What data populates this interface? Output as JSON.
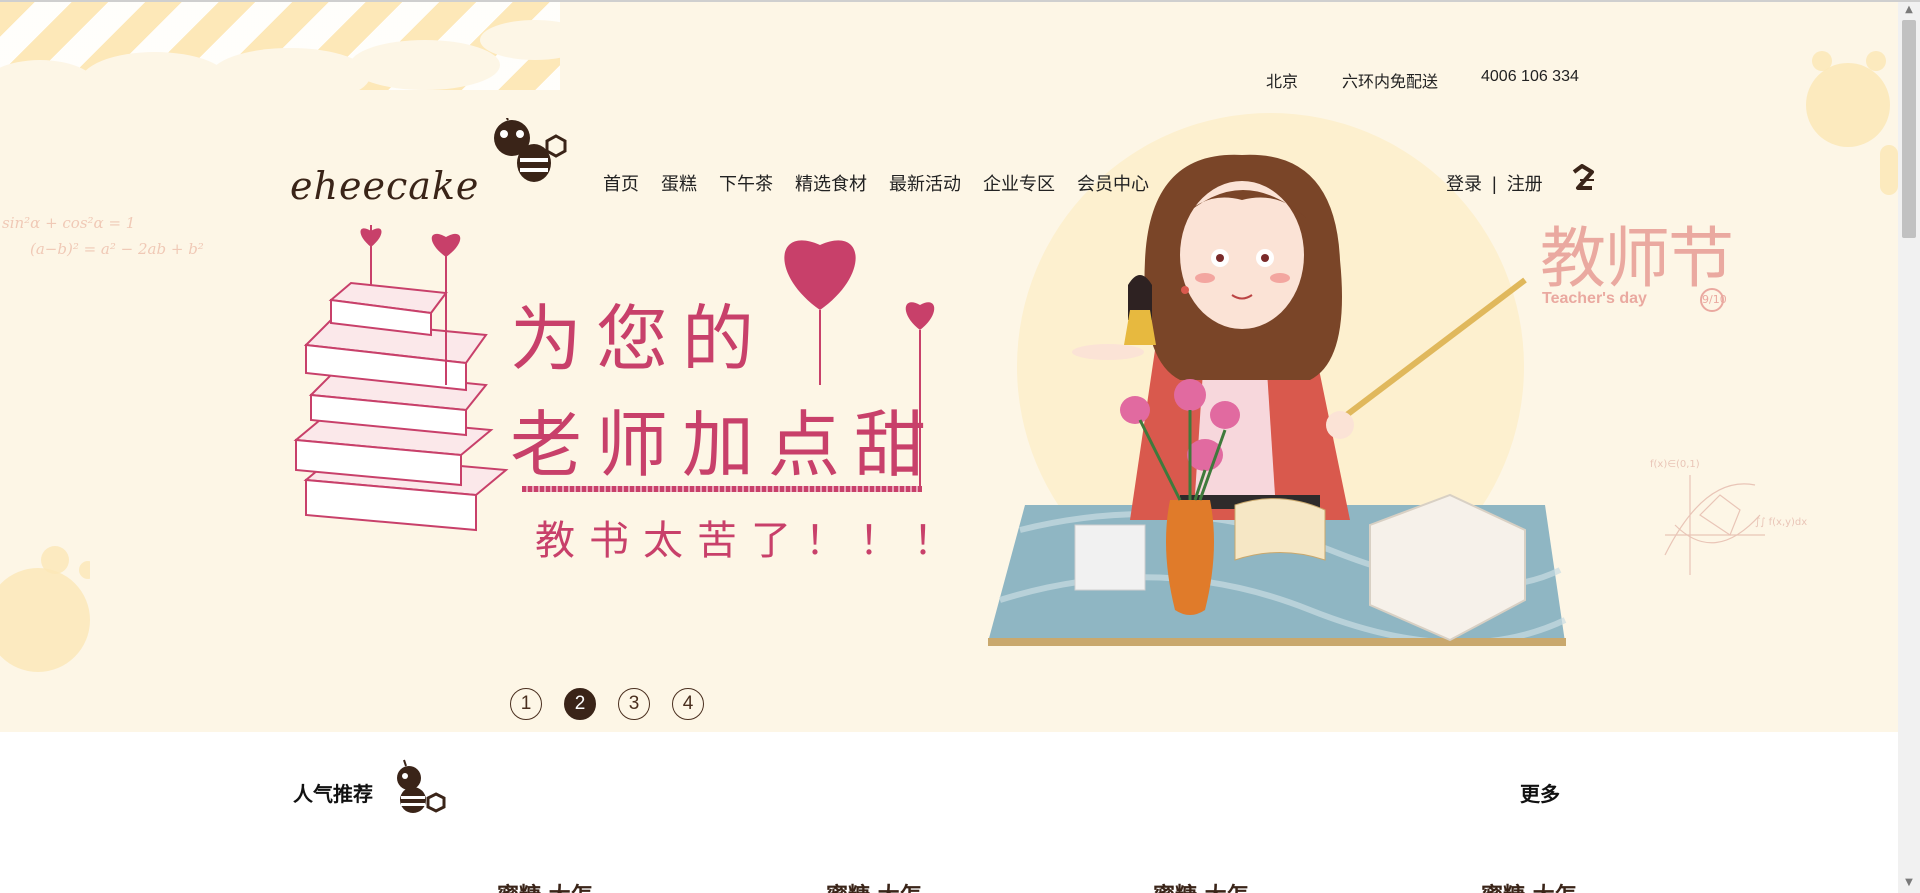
{
  "topbar": {
    "city": "北京",
    "shipping": "六环内免配送",
    "phone": "4006 106 334"
  },
  "brand": {
    "logo_text": "eheecake"
  },
  "nav": {
    "items": [
      "首页",
      "蛋糕",
      "下午茶",
      "精选食材",
      "最新活动",
      "企业专区",
      "会员中心"
    ]
  },
  "auth": {
    "login": "登录",
    "separator": "|",
    "register": "注册"
  },
  "banner": {
    "line1": "为您的",
    "line2": "老师加点甜",
    "line3": "教书太苦了！！！",
    "festival_title": "教师节",
    "festival_sub": "Teacher's day",
    "festival_badge": "9/10",
    "math_left_1": "sin²α + cos²α = 1",
    "math_left_2": "(a−b)² = a² − 2ab + b²",
    "pagination": [
      "1",
      "2",
      "3",
      "4"
    ],
    "active_page": "2"
  },
  "section": {
    "title": "人气推荐",
    "more": "更多"
  },
  "products_peek": [
    "蜜糖·大怎",
    "蜜糖·大怎",
    "蜜糖·大怎",
    "蜜糖·大怎"
  ],
  "colors": {
    "banner_bg": "#fdf6e6",
    "accent_pink": "#c8406a",
    "brand_brown": "#3a2418"
  }
}
